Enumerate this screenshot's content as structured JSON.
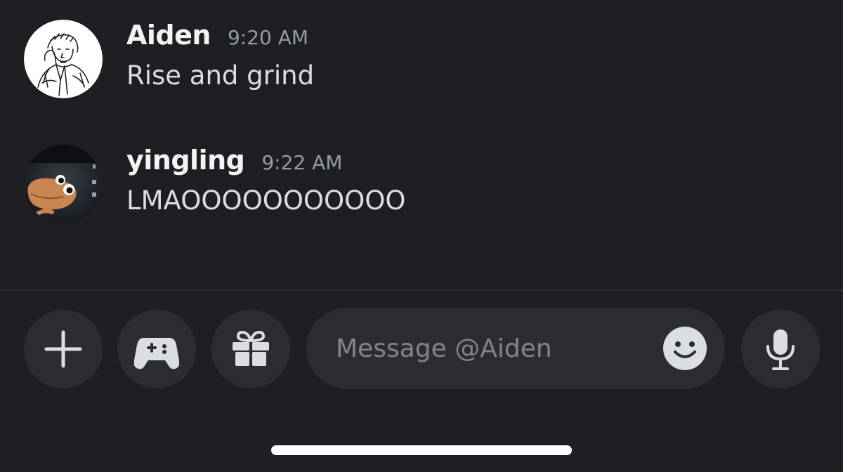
{
  "messages": [
    {
      "author": "Aiden",
      "time": "9:20 AM",
      "text": "Rise and grind",
      "avatar_icon": "sketch-portrait-avatar"
    },
    {
      "author": "yingling",
      "time": "9:22 AM",
      "text": "LMAOOOOOOOOOOO",
      "avatar_icon": "cartoon-creature-avatar"
    }
  ],
  "composer": {
    "placeholder": "Message @Aiden",
    "value": ""
  },
  "toolbar": {
    "buttons": [
      "plus-icon",
      "gamepad-icon",
      "gift-icon"
    ],
    "emoji_icon": "smile-icon",
    "mic_icon": "microphone-icon"
  },
  "colors": {
    "background": "#1e1f22",
    "surface": "#2b2d31",
    "username": "#f2f3f5",
    "timestamp": "#949ba4",
    "message_text": "#dbdee1",
    "icon": "#dbdee1",
    "placeholder": "#80848e"
  }
}
